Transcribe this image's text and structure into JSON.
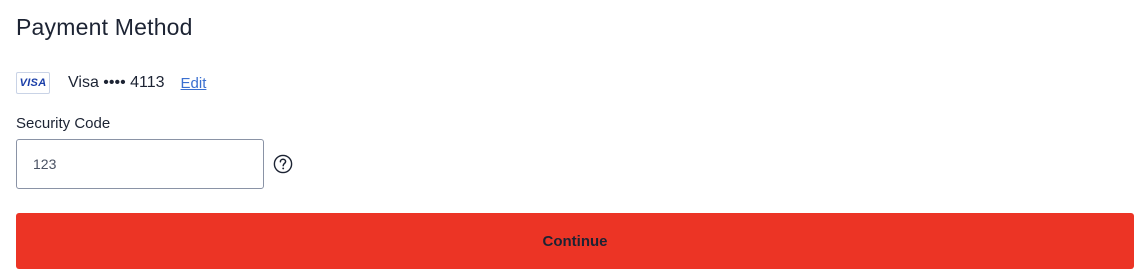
{
  "section": {
    "title": "Payment Method"
  },
  "card": {
    "brand_logo_text": "VISA",
    "description": "Visa •••• 4113",
    "edit_label": "Edit"
  },
  "security_code": {
    "label": "Security Code",
    "value": "123",
    "help_icon": "question-circle-icon"
  },
  "actions": {
    "continue_label": "Continue"
  },
  "colors": {
    "primary_button": "#ec3425",
    "link": "#3a6fd0",
    "text": "#1c2333",
    "visa_blue": "#1a3ea8"
  }
}
